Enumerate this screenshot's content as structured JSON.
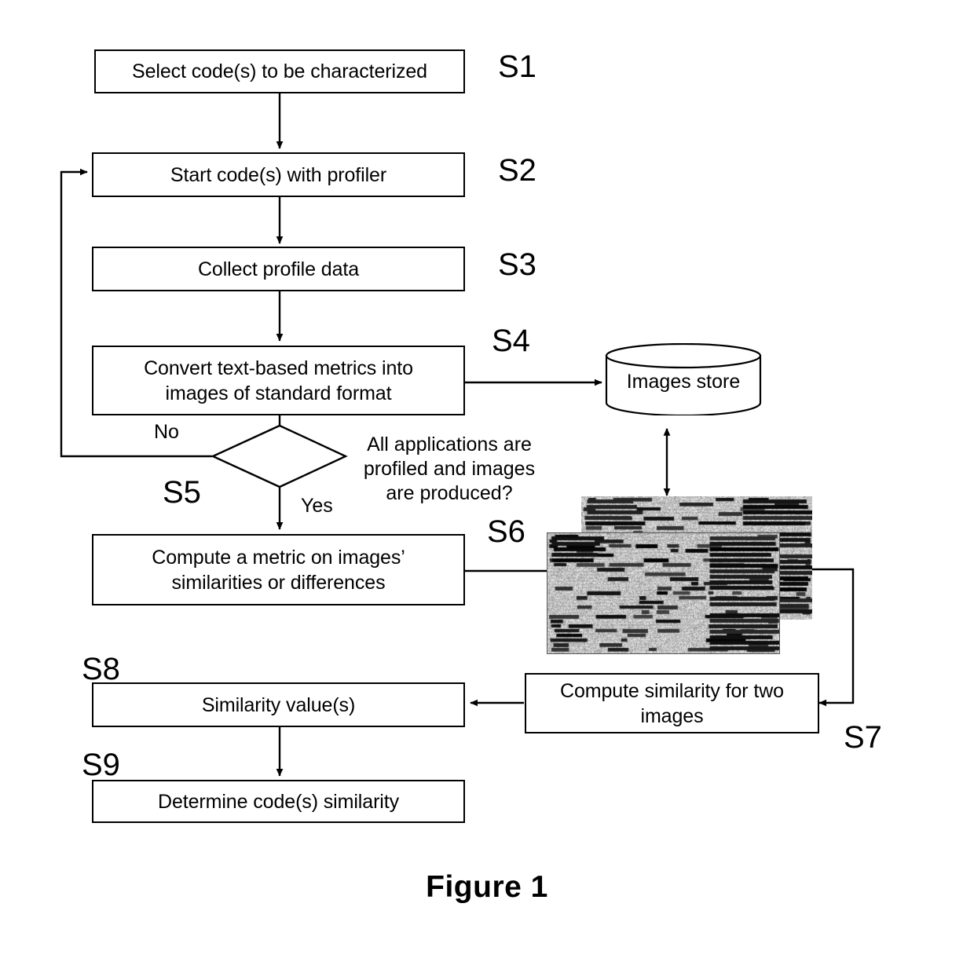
{
  "figure": {
    "caption": "Figure 1"
  },
  "nodes": [
    {
      "id": "S1",
      "label": "Select code(s) to be characterized"
    },
    {
      "id": "S2",
      "label": "Start code(s) with profiler"
    },
    {
      "id": "S3",
      "label": "Collect profile data"
    },
    {
      "id": "S4",
      "label": "Convert text-based metrics into\nimages of standard format"
    },
    {
      "id": "S5",
      "label": ""
    },
    {
      "id": "S6",
      "label": "Compute a metric on images’\nsimilarities or differences"
    },
    {
      "id": "S7",
      "label": "Compute similarity for two\nimages"
    },
    {
      "id": "S8",
      "label": "Similarity value(s)"
    },
    {
      "id": "S9",
      "label": "Determine code(s) similarity"
    }
  ],
  "step_ids": {
    "s1": "S1",
    "s2": "S2",
    "s3": "S3",
    "s4": "S4",
    "s5": "S5",
    "s6": "S6",
    "s7": "S7",
    "s8": "S8",
    "s9": "S9"
  },
  "decision": {
    "question": "All applications are\nprofiled and images\nare produced?",
    "yes_label": "Yes",
    "no_label": "No"
  },
  "datastore": {
    "label": "Images store"
  },
  "profile_images": {
    "back_name": "profile-image-back",
    "front_name": "profile-image-front"
  },
  "colors": {
    "stroke": "#000000",
    "background": "#ffffff",
    "image_noise_base": "#bdbdbd"
  }
}
